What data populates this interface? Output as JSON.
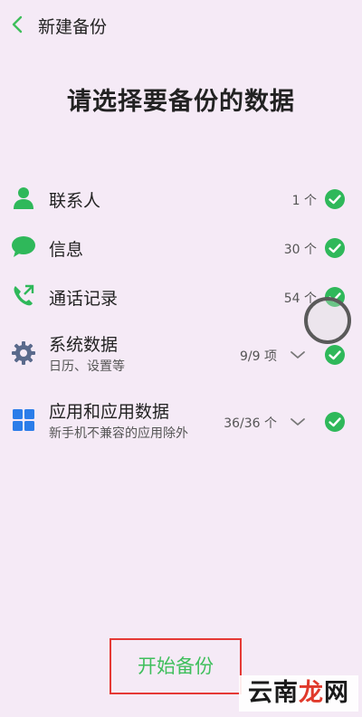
{
  "header": {
    "title": "新建备份"
  },
  "page_title": "请选择要备份的数据",
  "items": [
    {
      "label": "联系人",
      "count": "1 个",
      "icon": "person-icon",
      "checked": true
    },
    {
      "label": "信息",
      "count": "30 个",
      "icon": "message-icon",
      "checked": true
    },
    {
      "label": "通话记录",
      "count": "54 个",
      "icon": "phone-call-icon",
      "checked": true
    },
    {
      "label": "系统数据",
      "sub": "日历、设置等",
      "count": "9/9 项",
      "icon": "gear-icon",
      "checked": true
    },
    {
      "label": "应用和应用数据",
      "sub": "新手机不兼容的应用除外",
      "count": "36/36 个",
      "icon": "apps-grid-icon",
      "checked": true
    }
  ],
  "start_button": {
    "label": "开始备份"
  },
  "watermark": {
    "part1": "云南",
    "part2": "龙",
    "part3": "网"
  },
  "colors": {
    "background": "#f5eaf6",
    "accent_green": "#3fbf5c",
    "highlight_red": "#e53935"
  }
}
